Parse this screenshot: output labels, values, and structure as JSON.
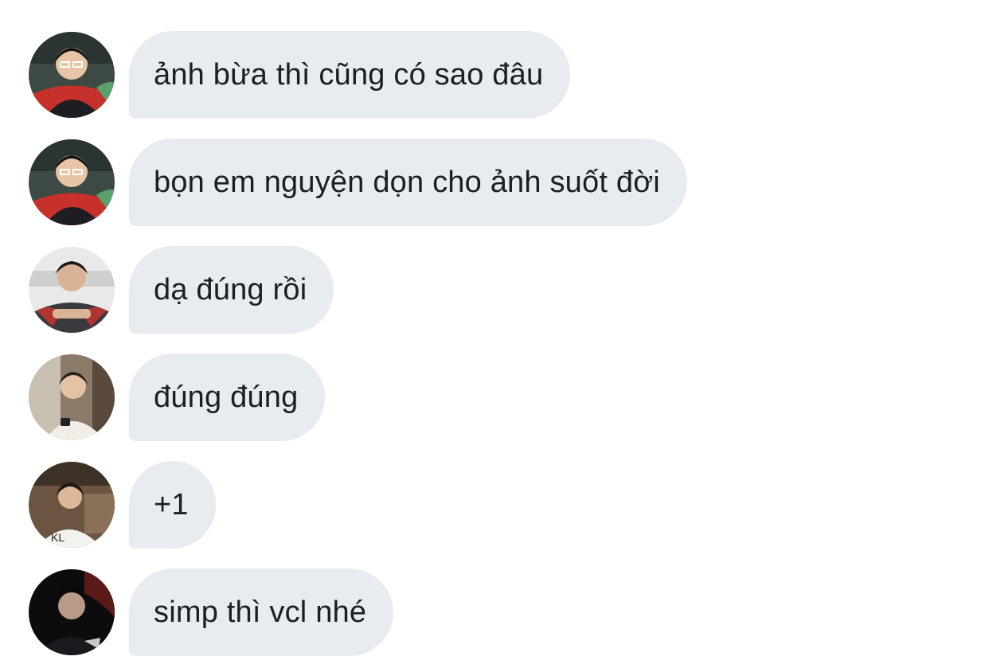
{
  "messages": [
    {
      "avatar_icon": "user-avatar-icon",
      "text": "ảnh bừa thì cũng có sao đâu"
    },
    {
      "avatar_icon": "user-avatar-icon",
      "text": "bọn em nguyện dọn cho ảnh suốt đời"
    },
    {
      "avatar_icon": "user-avatar-icon",
      "text": "dạ đúng rồi"
    },
    {
      "avatar_icon": "user-avatar-icon",
      "text": "đúng đúng"
    },
    {
      "avatar_icon": "user-avatar-icon",
      "text": "+1"
    },
    {
      "avatar_icon": "user-avatar-icon",
      "text": "simp thì vcl nhé"
    }
  ],
  "colors": {
    "bubble_background": "#e8ecf0",
    "text": "#1c1e21",
    "page_background": "#ffffff"
  }
}
